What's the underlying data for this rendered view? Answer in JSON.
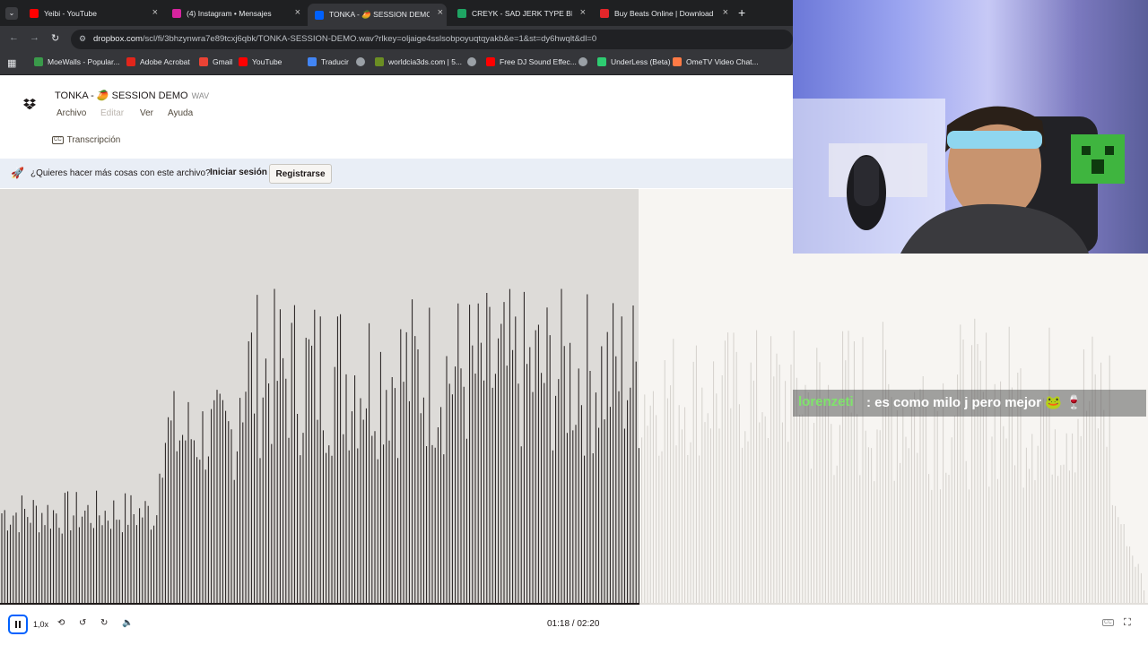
{
  "browser": {
    "tabs": [
      {
        "title": "Yeibi - YouTube",
        "icon": "youtube-icon",
        "color": "#ff0000",
        "active": false
      },
      {
        "title": "(4) Instagram • Mensajes",
        "icon": "instagram-icon",
        "color": "#d6249f",
        "active": false
      },
      {
        "title": "TONKA - 🥭 SESSION DEMO",
        "icon": "dropbox-icon",
        "color": "#0061fe",
        "active": true
      },
      {
        "title": "CREYK - SAD JERK TYPE BEAT -",
        "icon": "google-drive-icon",
        "color": "#1fa463",
        "active": false
      },
      {
        "title": "Buy Beats Online | Download Be",
        "icon": "beatstars-icon",
        "color": "#e2262a",
        "active": false
      }
    ],
    "new_tab": "+",
    "url_host": "dropbox.com",
    "url_path": "/scl/fi/3bhzynwra7e89tcxj6qbk/TONKA-SESSION-DEMO.wav?rlkey=oljaige4sslsobpoyuqtqyakb&e=1&st=dy6hwqlt&dl=0",
    "bookmarks": [
      {
        "label": "MoeWalls - Popular...",
        "icon": "moewalls-icon",
        "color": "#3a9a4a"
      },
      {
        "label": "Adobe Acrobat",
        "icon": "acrobat-icon",
        "color": "#e1251b"
      },
      {
        "label": "Gmail",
        "icon": "gmail-icon",
        "color": "#ea4335"
      },
      {
        "label": "YouTube",
        "icon": "youtube-icon",
        "color": "#ff0000"
      },
      {
        "label": "Traducir",
        "icon": "translate-icon",
        "color": "#4285f4"
      },
      {
        "label": "",
        "icon": "globe-icon",
        "color": "#9aa0a6"
      },
      {
        "label": "worldcia3ds.com | 5...",
        "icon": "site-icon",
        "color": "#6b8e23"
      },
      {
        "label": "",
        "icon": "globe-icon",
        "color": "#9aa0a6"
      },
      {
        "label": "Free DJ Sound Effec...",
        "icon": "youtube-icon",
        "color": "#ff0000"
      },
      {
        "label": "",
        "icon": "globe-icon",
        "color": "#9aa0a6"
      },
      {
        "label": "UnderLess (Beta)",
        "icon": "underless-icon",
        "color": "#2ecc71"
      },
      {
        "label": "OmeTV Video Chat...",
        "icon": "ometv-icon",
        "color": "#ff7a45"
      }
    ]
  },
  "file": {
    "name": "TONKA - 🥭 SESSION DEMO",
    "ext": "WAV"
  },
  "menu": {
    "archivo": "Archivo",
    "editar": "Editar",
    "ver": "Ver",
    "ayuda": "Ayuda",
    "transcripcion": "Transcripción"
  },
  "banner": {
    "text": "¿Quieres hacer más cosas con este archivo?",
    "login": "Iniciar sesión",
    "signup": "Registrarse"
  },
  "player": {
    "speed": "1,0x",
    "current_time": "01:18",
    "total_time": "02:20",
    "time_display": "01:18 / 02:20",
    "progress": 0.557
  },
  "overlay": {
    "chat_user": "lorenzeti",
    "chat_message": ": es como milo j pero mejor 🐸 🍷"
  }
}
